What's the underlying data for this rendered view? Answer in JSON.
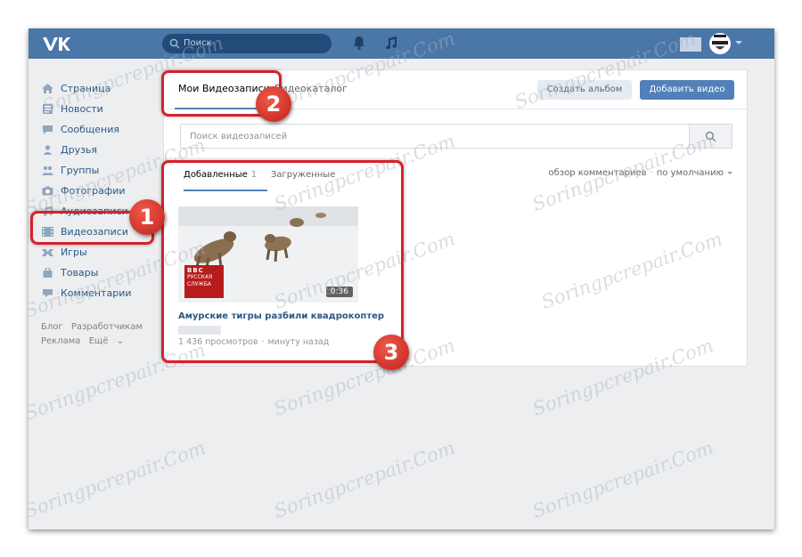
{
  "header": {
    "logo_text": "VK",
    "search_placeholder": "Поиск"
  },
  "sidebar": {
    "items": [
      {
        "label": "Страница",
        "icon": "home-icon"
      },
      {
        "label": "Новости",
        "icon": "news-icon"
      },
      {
        "label": "Сообщения",
        "icon": "messages-icon"
      },
      {
        "label": "Друзья",
        "icon": "friends-icon"
      },
      {
        "label": "Группы",
        "icon": "groups-icon"
      },
      {
        "label": "Фотографии",
        "icon": "camera-icon"
      },
      {
        "label": "Аудиозаписи",
        "icon": "music-icon"
      },
      {
        "label": "Видеозаписи",
        "icon": "video-icon"
      },
      {
        "label": "Игры",
        "icon": "games-icon"
      },
      {
        "label": "Товары",
        "icon": "shopping-bag-icon"
      },
      {
        "label": "Комментарии",
        "icon": "comments-icon"
      }
    ],
    "footer_links": [
      "Блог",
      "Разработчикам",
      "Реклама",
      "Ещё"
    ]
  },
  "video_page": {
    "tabs": [
      "Мои Видеозаписи",
      "Видеокаталог"
    ],
    "create_album_label": "Создать альбом",
    "add_video_label": "Добавить видео",
    "search_placeholder": "Поиск видеозаписей",
    "subtabs": {
      "added_label": "Добавленные",
      "added_count": "1",
      "uploaded_label": "Загруженные"
    },
    "sort": {
      "comments_label": "обзор комментариев",
      "order_label": "по умолчанию"
    },
    "video": {
      "title": "Амурские тигры разбили квадрокоптер",
      "duration": "0:36",
      "channel_badge_logo": "BBC",
      "channel_badge_text": "РУССКАЯ СЛУЖБА",
      "views": "1 436 просмотров",
      "time": "минуту назад"
    }
  },
  "annotations": {
    "badge_1": "1",
    "badge_2": "2",
    "badge_3": "3",
    "highlight_color": "#d8202c"
  },
  "watermark": "Soringpcrepair.Com",
  "colors": {
    "header_bg": "#4a76a8",
    "page_bg": "#edeef0",
    "accent": "#5181b8",
    "link": "#2a5885"
  }
}
